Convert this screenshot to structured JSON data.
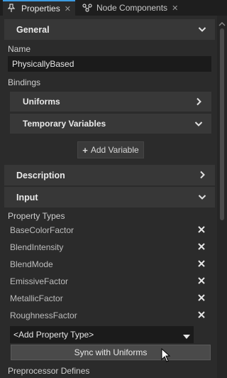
{
  "tabs": [
    {
      "label": "Properties",
      "active": true,
      "icon": "pin-icon"
    },
    {
      "label": "Node Components",
      "active": false,
      "icon": "nodes-icon"
    }
  ],
  "general": {
    "header": "General",
    "name_label": "Name",
    "name_value": "PhysicallyBased",
    "bindings_label": "Bindings",
    "uniforms": "Uniforms",
    "temporary_variables": "Temporary Variables",
    "add_variable": "Add Variable"
  },
  "description": {
    "header": "Description"
  },
  "input": {
    "header": "Input",
    "property_types_label": "Property Types",
    "property_types": [
      "BaseColorFactor",
      "BlendIntensity",
      "BlendMode",
      "EmissiveFactor",
      "MetallicFactor",
      "RoughnessFactor"
    ],
    "add_property_type": "<Add Property Type>",
    "sync_button": "Sync with Uniforms",
    "preprocessor_label": "Preprocessor Defines"
  },
  "colors": {
    "background": "#2b2b2b",
    "header": "#373737",
    "field": "#1b1b1b",
    "accent": "#3c9be0"
  }
}
